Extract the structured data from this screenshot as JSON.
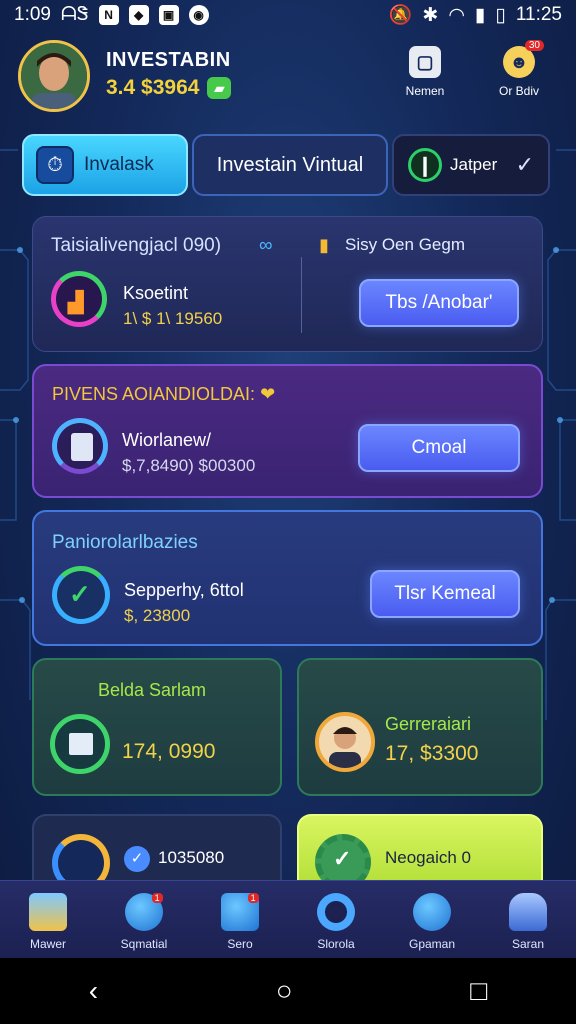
{
  "status_bar": {
    "time": "1:09",
    "left_text": "ᗩᏕ",
    "right_time": "11:25"
  },
  "header": {
    "app_name": "INVESTABIN",
    "balance": "3.4 $3964",
    "btn_left_label": "Nemen",
    "btn_right_label": "Or Bdiv",
    "btn_right_badge": "30"
  },
  "tabs": [
    {
      "label": "Invalask",
      "icon": "stopwatch-icon",
      "active": true
    },
    {
      "label": "Investain Vintual",
      "active": false
    },
    {
      "label": "Jatper",
      "icon": "pin-icon",
      "active": false
    }
  ],
  "cards": {
    "card1": {
      "title": "Taisialivengjacl 090)",
      "item_name": "Ksoetint",
      "item_value": "1\\ $ 1\\ 19560",
      "right_title": "Sisy Oen Gegm",
      "button": "Tbs /Anobar'"
    },
    "card2": {
      "title": "PIVENS AOIANDIOLDAI: ❤",
      "item_name": "Wiorlanew/",
      "item_value": "$,7,8490) $00300",
      "button": "Cmoal"
    },
    "card3": {
      "title": "Paniorolarlbazies",
      "item_name": "Sepperhy, 6ttol",
      "item_value": "$, 23800",
      "button": "Tlsr Kemeal"
    }
  },
  "tiles": [
    {
      "title": "Belda Sarlam",
      "value": "174, 0990"
    },
    {
      "title": "Gerreraiari",
      "value": "17, $3300"
    }
  ],
  "bottom_cards": [
    {
      "value": "1035080"
    },
    {
      "value": "Neogaich 0"
    }
  ],
  "nav": [
    {
      "label": "Mawer"
    },
    {
      "label": "Sqmatial",
      "badge": "1"
    },
    {
      "label": "Sero",
      "badge": "1"
    },
    {
      "label": "Slorola"
    },
    {
      "label": "Gpaman"
    },
    {
      "label": "Saran"
    }
  ],
  "colors": {
    "accent_gold": "#f2d24a",
    "accent_cyan": "#49d6ff",
    "button_blue": "#5a70f5",
    "tile_green": "#a5e84a"
  }
}
